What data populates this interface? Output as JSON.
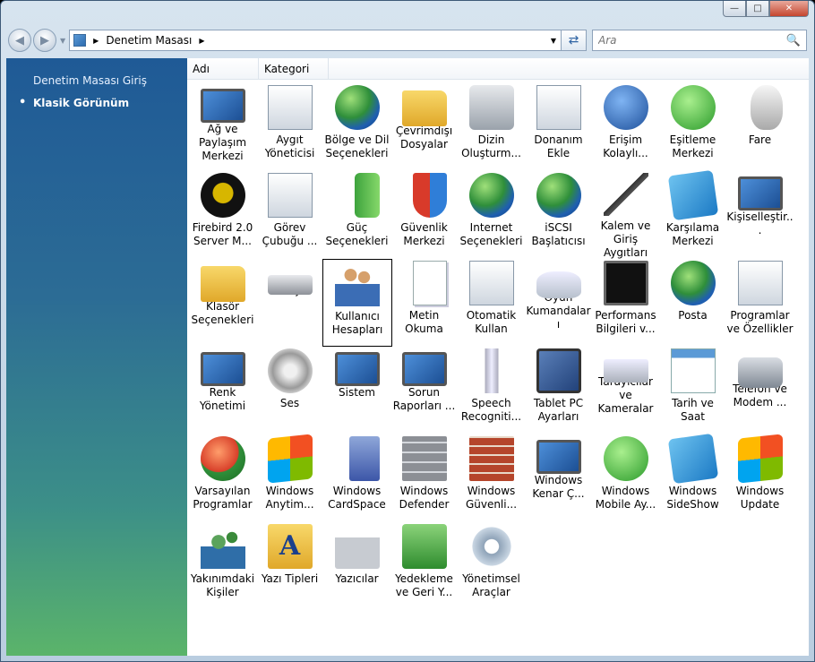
{
  "window": {
    "caption_buttons": [
      "minimize-icon",
      "maximize-icon",
      "close-icon"
    ]
  },
  "navbar": {
    "address": "Denetim Masası",
    "search_placeholder": "Ara"
  },
  "sidebar": {
    "items": [
      {
        "label": "Denetim Masası Giriş",
        "active": false
      },
      {
        "label": "Klasik Görünüm",
        "active": true
      }
    ]
  },
  "columns": {
    "name": "Adı",
    "category": "Kategori"
  },
  "items": [
    {
      "label": "Ağ ve Paylaşım Merkezi",
      "icon": "network-icon"
    },
    {
      "label": "Aygıt Yöneticisi",
      "icon": "device-manager-icon"
    },
    {
      "label": "Bölge ve Dil Seçenekleri",
      "icon": "regional-globe-icon"
    },
    {
      "label": "Çevrimdışı Dosyalar",
      "icon": "offline-files-folder-icon"
    },
    {
      "label": "Dizin Oluşturm...",
      "icon": "indexing-icon"
    },
    {
      "label": "Donanım Ekle",
      "icon": "add-hardware-icon"
    },
    {
      "label": "Erişim Kolaylı...",
      "icon": "accessibility-icon"
    },
    {
      "label": "Eşitleme Merkezi",
      "icon": "sync-center-icon"
    },
    {
      "label": "Fare",
      "icon": "mouse-icon"
    },
    {
      "label": "Firebird 2.0 Server M...",
      "icon": "firebird-icon"
    },
    {
      "label": "Görev Çubuğu ...",
      "icon": "taskbar-icon"
    },
    {
      "label": "Güç Seçenekleri",
      "icon": "power-battery-icon"
    },
    {
      "label": "Güvenlik Merkezi",
      "icon": "security-shield-icon"
    },
    {
      "label": "Internet Seçenekleri",
      "icon": "internet-globe-icon"
    },
    {
      "label": "iSCSI Başlatıcısı",
      "icon": "iscsi-globe-icon"
    },
    {
      "label": "Kalem ve Giriş Aygıtları",
      "icon": "pen-icon"
    },
    {
      "label": "Karşılama Merkezi",
      "icon": "welcome-center-icon"
    },
    {
      "label": "Kişiselleştir...",
      "icon": "personalize-monitor-icon"
    },
    {
      "label": "Klasör Seçenekleri",
      "icon": "folder-options-icon"
    },
    {
      "label": "Klavye",
      "icon": "keyboard-icon"
    },
    {
      "label": "Kullanıcı Hesapları",
      "icon": "user-accounts-icon"
    },
    {
      "label": "Metin Okuma",
      "icon": "text-to-speech-icon"
    },
    {
      "label": "Otomatik Kullan",
      "icon": "autoplay-icon"
    },
    {
      "label": "Oyun Kumandaları",
      "icon": "game-controller-icon"
    },
    {
      "label": "Performans Bilgileri v...",
      "icon": "performance-monitor-icon"
    },
    {
      "label": "Posta",
      "icon": "mail-icon"
    },
    {
      "label": "Programlar ve Özellikler",
      "icon": "programs-features-icon"
    },
    {
      "label": "Renk Yönetimi",
      "icon": "color-management-icon"
    },
    {
      "label": "Ses",
      "icon": "sound-speaker-icon"
    },
    {
      "label": "Sistem",
      "icon": "system-monitor-icon"
    },
    {
      "label": "Sorun Raporları ...",
      "icon": "problem-reports-icon"
    },
    {
      "label": "Speech Recogniti...",
      "icon": "microphone-icon"
    },
    {
      "label": "Tablet PC Ayarları",
      "icon": "tablet-icon"
    },
    {
      "label": "Tarayıcılar ve Kameralar",
      "icon": "scanner-camera-icon"
    },
    {
      "label": "Tarih ve Saat",
      "icon": "date-time-icon"
    },
    {
      "label": "Telefon ve Modem ...",
      "icon": "phone-modem-icon"
    },
    {
      "label": "Varsayılan Programlar",
      "icon": "default-programs-icon"
    },
    {
      "label": "Windows Anytim...",
      "icon": "windows-anytime-icon"
    },
    {
      "label": "Windows CardSpace",
      "icon": "cardspace-icon"
    },
    {
      "label": "Windows Defender",
      "icon": "defender-wall-icon"
    },
    {
      "label": "Windows Güvenli...",
      "icon": "firewall-icon"
    },
    {
      "label": "Windows Kenar Ç...",
      "icon": "sidebar-icon"
    },
    {
      "label": "Windows Mobile Ay...",
      "icon": "mobile-device-icon"
    },
    {
      "label": "Windows SideShow",
      "icon": "sideshow-icon"
    },
    {
      "label": "Windows Update",
      "icon": "windows-update-icon"
    },
    {
      "label": "Yakınımdaki Kişiler",
      "icon": "people-near-me-icon"
    },
    {
      "label": "Yazı Tipleri",
      "icon": "fonts-folder-icon"
    },
    {
      "label": "Yazıcılar",
      "icon": "printer-icon"
    },
    {
      "label": "Yedekleme ve Geri Y...",
      "icon": "backup-restore-icon"
    },
    {
      "label": "Yönetimsel Araçlar",
      "icon": "admin-tools-icon"
    }
  ],
  "selected_item": "Kullanıcı Hesapları"
}
